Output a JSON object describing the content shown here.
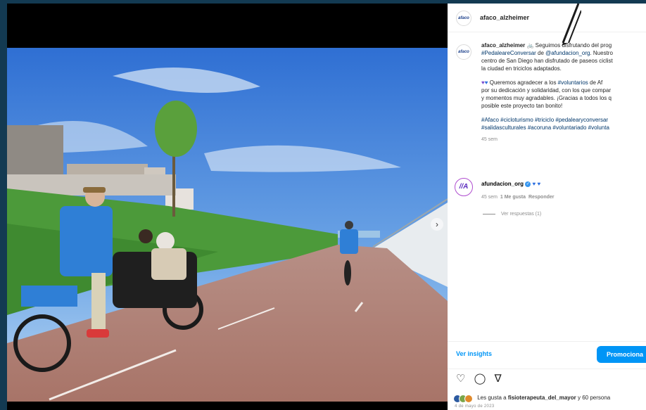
{
  "post": {
    "username": "afaco_alzheimer",
    "avatar_text": "afaco"
  },
  "caption": {
    "username": "afaco_alzheimer",
    "line1": "🚲 Seguimos disfrutando del prog",
    "line2_tag": "#PedaleareConversar",
    "line2_rest": " de ",
    "line2_mention": "@afundacion_org",
    "line2_tail": ". Nuestro",
    "line3": "centro de San Diego han disfrutado de paseos ciclist",
    "line4": "la ciudad en triciclos adaptados.",
    "para2_line1_pre": "Queremos agradecer a los ",
    "para2_line1_tag": "#voluntarios",
    "para2_line1_post": " de Af",
    "para2_line2": "por su dedicación y solidaridad, con los que compar",
    "para2_line3": "y momentos muy agradables. ¡Gracias a todos los q",
    "para2_line4": "posible este proyecto tan bonito!",
    "hashtags_line1": "#Afaco #cicloturismo #triciclo #pedalearyconversar",
    "hashtags_line2": "#salidasculturales #acoruna #voluntariado #volunta",
    "time": "45 sem"
  },
  "comment": {
    "avatar_text": "//A",
    "username": "afundacion_org",
    "hearts": "♥ ♥",
    "time": "45 sem",
    "likes": "1 Me gusta",
    "reply": "Responder",
    "view_replies": "Ver respuestas (1)"
  },
  "insights_label": "Ver insights",
  "promote_label": "Promociona",
  "likes": {
    "prefix": "Les gusta a ",
    "user": "fisioterapeuta_del_mayor",
    "suffix": " y 60 persona"
  },
  "date": "4 de mayo de 2023",
  "colors": {
    "frame": "#133a52",
    "accent_blue": "#0095f6",
    "hashtag": "#00376b",
    "vest_blue": "#2f7fd6"
  },
  "icons": {
    "like": "heart-outline-icon",
    "comment": "comment-bubble-icon",
    "share": "paper-plane-icon",
    "next": "chevron-right-icon"
  }
}
